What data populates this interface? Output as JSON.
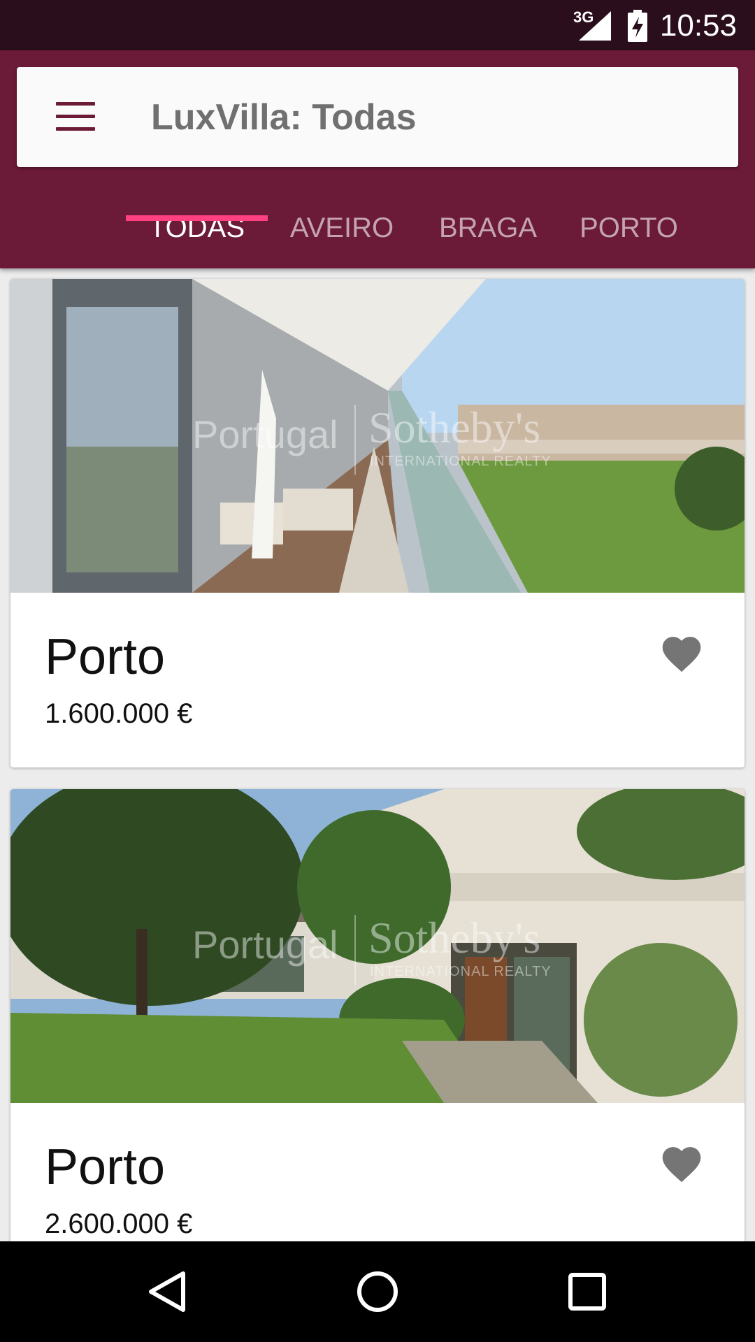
{
  "status_bar": {
    "network": "3G",
    "time": "10:53",
    "icons": [
      "signal-icon",
      "battery-icon"
    ]
  },
  "header": {
    "title": "LuxVilla: Todas",
    "menu_icon": "hamburger-menu-icon",
    "tabs": [
      {
        "label": "TODAS",
        "active": true
      },
      {
        "label": "AVEIRO",
        "active": false
      },
      {
        "label": "BRAGA",
        "active": false
      },
      {
        "label": "PORTO",
        "active": false
      }
    ]
  },
  "listings": [
    {
      "city": "Porto",
      "price": "1.600.000 €",
      "watermark": {
        "left": "Portugal",
        "right": "Sotheby's",
        "sub": "INTERNATIONAL REALTY"
      },
      "favorite_icon": "heart-icon"
    },
    {
      "city": "Porto",
      "price": "2.600.000 €",
      "watermark": {
        "left": "Portugal",
        "right": "Sotheby's",
        "sub": "INTERNATIONAL REALTY"
      },
      "favorite_icon": "heart-icon"
    }
  ],
  "nav_bar": {
    "icons": [
      "back-icon",
      "home-icon",
      "recents-icon"
    ]
  },
  "colors": {
    "primary": "#6b1a38",
    "status_bar": "#2b0e1b",
    "accent": "#ff4081",
    "heart": "#757575"
  }
}
